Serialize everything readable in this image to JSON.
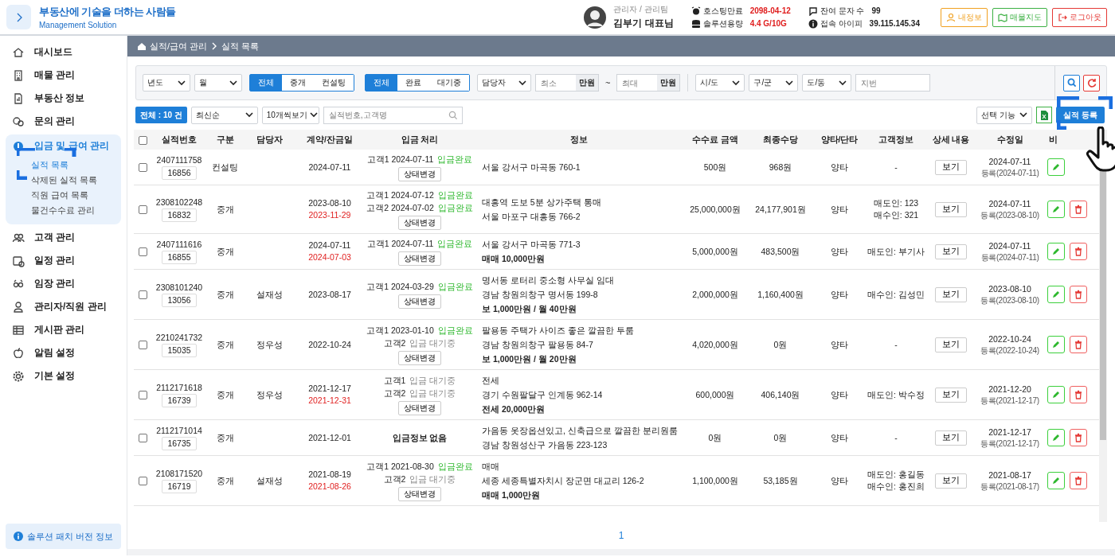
{
  "header": {
    "brand_title": "부동산에 기술을 더하는 사람들",
    "brand_subtitle": "Management Solution",
    "user_role": "관리자 / 관리팀",
    "user_name": "김부기 대표님",
    "stats": [
      {
        "label": "호스팅만료",
        "value": "2098-04-12",
        "color": "#e02020"
      },
      {
        "label": "솔루션용량",
        "value": "4.4 G/10G",
        "color": "#e02020"
      },
      {
        "label": "잔여 문자 수",
        "value": "99",
        "color": "#222222"
      },
      {
        "label": "접속 아이피",
        "value": "39.115.145.34",
        "color": "#222222"
      }
    ],
    "buttons": [
      {
        "label": "내정보",
        "color": "#f0a020"
      },
      {
        "label": "매물지도",
        "color": "#3cb043"
      },
      {
        "label": "로그아웃",
        "color": "#e53935"
      }
    ]
  },
  "sidebar": {
    "items": [
      {
        "label": "대시보드",
        "expanded": false
      },
      {
        "label": "매물 관리",
        "expanded": false
      },
      {
        "label": "부동산 정보",
        "expanded": false
      },
      {
        "label": "문의 관리",
        "expanded": false
      },
      {
        "label": "입금 및 급여 관리",
        "expanded": true,
        "children": [
          {
            "label": "실적 목록",
            "selected": true
          },
          {
            "label": "삭제된 실적 목록",
            "selected": false
          },
          {
            "label": "직원 급여 목록",
            "selected": false
          },
          {
            "label": "물건수수료 관리",
            "selected": false
          }
        ]
      },
      {
        "label": "고객 관리",
        "expanded": false
      },
      {
        "label": "일정 관리",
        "expanded": false
      },
      {
        "label": "임장 관리",
        "expanded": false
      },
      {
        "label": "관리자/직원 관리",
        "expanded": false
      },
      {
        "label": "게시판 관리",
        "expanded": false
      },
      {
        "label": "알림 설정",
        "expanded": false
      },
      {
        "label": "기본 설정",
        "expanded": false
      }
    ],
    "footer": "솔루션 패치 버전 정보"
  },
  "breadcrumb": [
    "실적/급여 관리",
    "실적 목록"
  ],
  "filters": {
    "year": "년도",
    "month": "월",
    "segments": [
      [
        {
          "label": "전체",
          "selected": true
        },
        {
          "label": "중개",
          "selected": false
        },
        {
          "label": "컨설팅",
          "selected": false
        }
      ],
      [
        {
          "label": "전체",
          "selected": true
        },
        {
          "label": "완료",
          "selected": false
        },
        {
          "label": "대기중",
          "selected": false
        }
      ]
    ],
    "manager": "담당자",
    "min_placeholder": "최소",
    "unit_min": "만원",
    "range_sep": "~",
    "max_placeholder": "최대",
    "unit_max": "만원",
    "regions": [
      "시/도",
      "구/군",
      "도/동"
    ],
    "lot_placeholder": "지번"
  },
  "toolbar": {
    "total": "전체 : 10 건",
    "sort": "최신순",
    "per_page": "10개씩보기",
    "search_placeholder": "실적번호,고객명",
    "bulk": "선택 기능",
    "register": "실적 등록"
  },
  "table": {
    "all_checked": false,
    "columns": [
      "실적번호",
      "구분",
      "담당자",
      "계약/잔금일",
      "입금 처리",
      "정보",
      "수수료 금액",
      "최종수당",
      "양타/단타",
      "고객정보",
      "상세 내용",
      "수정일",
      "비"
    ],
    "rows": [
      {
        "checked": false,
        "number": "2407111758",
        "code": "16856",
        "category": "컨설팅",
        "contract_date": "2024-07-11",
        "payments": [
          {
            "customer": "고객1",
            "date": "2024-07-11",
            "status": "입금완료",
            "paid": true
          }
        ],
        "status_button": "상태변경",
        "info": [
          {
            "text": "서울 강서구 마곡동 760-1",
            "bold": false
          }
        ],
        "fee": "500원",
        "allowance": "968원",
        "trade": "양타",
        "customer_info": [
          "-"
        ],
        "detail": "보기",
        "modified": "2024-07-11",
        "registered": "등록(2024-07-11)",
        "actions": [
          {
            "kind": "edit"
          }
        ]
      },
      {
        "checked": false,
        "number": "2308102248",
        "code": "16832",
        "category": "중개",
        "contract_date": "2023-08-10",
        "balance_date": "2023-11-29",
        "payments": [
          {
            "customer": "고객1",
            "date": "2024-07-12",
            "status": "입금완료",
            "paid": true
          },
          {
            "customer": "고객2",
            "date": "2024-07-02",
            "status": "입금완료",
            "paid": true
          }
        ],
        "status_button": "상태변경",
        "info": [
          {
            "text": "대흥역 도보 5분 상가주택 통매",
            "bold": false
          },
          {
            "text": "서울 마포구 대흥동 766-2",
            "bold": false
          }
        ],
        "fee": "25,000,000원",
        "allowance": "24,177,901원",
        "trade": "양타",
        "customer_info": [
          "매도인: 123",
          "매수인: 321"
        ],
        "detail": "보기",
        "modified": "2024-07-11",
        "registered": "등록(2023-08-10)",
        "actions": [
          {
            "kind": "edit"
          },
          {
            "kind": "delete"
          }
        ]
      },
      {
        "checked": false,
        "number": "2407111616",
        "code": "16855",
        "category": "중개",
        "contract_date": "2024-07-11",
        "balance_date": "2024-07-03",
        "payments": [
          {
            "customer": "고객1",
            "date": "2024-07-11",
            "status": "입금완료",
            "paid": true
          }
        ],
        "status_button": "상태변경",
        "info": [
          {
            "text": "서울 강서구 마곡동 771-3",
            "bold": false
          },
          {
            "text": "매매 10,000만원",
            "bold": true
          }
        ],
        "fee": "5,000,000원",
        "allowance": "483,500원",
        "trade": "양타",
        "customer_info": [
          "매도인: 부기사"
        ],
        "detail": "보기",
        "modified": "2024-07-11",
        "registered": "등록(2024-07-11)",
        "actions": [
          {
            "kind": "edit"
          },
          {
            "kind": "delete"
          }
        ]
      },
      {
        "checked": false,
        "number": "2308101240",
        "code": "13056",
        "category": "중개",
        "manager": "설재성",
        "contract_date": "2023-08-17",
        "payments": [
          {
            "customer": "고객1",
            "date": "2024-03-29",
            "status": "입금완료",
            "paid": true
          }
        ],
        "status_button": "상태변경",
        "info": [
          {
            "text": "명서동 로터리 중소형 사무실 임대",
            "bold": false
          },
          {
            "text": "경남 창원의창구 명서동 199-8",
            "bold": false
          },
          {
            "text": "보 1,000만원 / 월 40만원",
            "bold": true
          }
        ],
        "fee": "2,000,000원",
        "allowance": "1,160,400원",
        "trade": "양타",
        "customer_info": [
          "매수인: 김성민"
        ],
        "detail": "보기",
        "modified": "2023-08-10",
        "registered": "등록(2023-08-10)",
        "actions": [
          {
            "kind": "edit"
          },
          {
            "kind": "delete"
          }
        ]
      },
      {
        "checked": false,
        "number": "2210241732",
        "code": "15035",
        "category": "중개",
        "manager": "정우성",
        "contract_date": "2022-10-24",
        "payments": [
          {
            "customer": "고객1",
            "date": "2023-01-10",
            "status": "입금완료",
            "paid": true
          },
          {
            "customer": "고객2",
            "status": "입금 대기중",
            "paid": false
          }
        ],
        "status_button": "상태변경",
        "info": [
          {
            "text": "팔용동 주택가 사이즈 좋은 깔끔한 투룸",
            "bold": false
          },
          {
            "text": "경남 창원의창구 팔용동 84-7",
            "bold": false
          },
          {
            "text": "보 1,000만원 / 월 20만원",
            "bold": true
          }
        ],
        "fee": "4,020,000원",
        "allowance": "0원",
        "trade": "양타",
        "customer_info": [
          "-"
        ],
        "detail": "보기",
        "modified": "2022-10-24",
        "registered": "등록(2022-10-24)",
        "actions": [
          {
            "kind": "edit"
          },
          {
            "kind": "delete"
          }
        ]
      },
      {
        "checked": false,
        "number": "2112171618",
        "code": "16739",
        "category": "중개",
        "manager": "정우성",
        "contract_date": "2021-12-17",
        "balance_date": "2021-12-31",
        "payments": [
          {
            "customer": "고객1",
            "status": "입금 대기중",
            "paid": false
          },
          {
            "customer": "고객2",
            "status": "입금 대기중",
            "paid": false
          }
        ],
        "status_button": "상태변경",
        "info": [
          {
            "text": "전세",
            "bold": false
          },
          {
            "text": "경기 수원팔달구 인계동 962-14",
            "bold": false
          },
          {
            "text": "전세 20,000만원",
            "bold": true
          }
        ],
        "fee": "600,000원",
        "allowance": "406,140원",
        "trade": "양타",
        "customer_info": [
          "매도인: 박수정"
        ],
        "detail": "보기",
        "modified": "2021-12-20",
        "registered": "등록(2021-12-17)",
        "actions": [
          {
            "kind": "edit"
          },
          {
            "kind": "delete"
          }
        ]
      },
      {
        "checked": false,
        "number": "2112171014",
        "code": "16735",
        "category": "중개",
        "contract_date": "2021-12-01",
        "payment_note": "입금정보 없음",
        "info": [
          {
            "text": "가음동 옷장옵션있고, 신축급으로 깔끔한 분리원룸",
            "bold": false
          },
          {
            "text": "경남 창원성산구 가음동 223-123",
            "bold": false
          }
        ],
        "fee": "0원",
        "allowance": "0원",
        "trade": "양타",
        "customer_info": [
          "-"
        ],
        "detail": "보기",
        "modified": "2021-12-17",
        "registered": "등록(2021-12-17)",
        "actions": [
          {
            "kind": "edit"
          },
          {
            "kind": "delete"
          }
        ]
      },
      {
        "checked": false,
        "number": "2108171520",
        "code": "16719",
        "category": "중개",
        "manager": "설재성",
        "contract_date": "2021-08-19",
        "balance_date": "2021-08-26",
        "payments": [
          {
            "customer": "고객1",
            "date": "2021-08-30",
            "status": "입금완료",
            "paid": true
          },
          {
            "customer": "고객2",
            "status": "입금 대기중",
            "paid": false
          }
        ],
        "status_button": "상태변경",
        "info": [
          {
            "text": "매매",
            "bold": false
          },
          {
            "text": "세종 세종특별자치시 장군면 대교리 126-2",
            "bold": false
          },
          {
            "text": "매매 1,000만원",
            "bold": true
          }
        ],
        "fee": "1,100,000원",
        "allowance": "53,185원",
        "trade": "양타",
        "customer_info": [
          "매도인: 홍길동",
          "매수인: 홍진희"
        ],
        "detail": "보기",
        "modified": "2021-08-17",
        "registered": "등록(2021-08-17)",
        "actions": [
          {
            "kind": "edit"
          },
          {
            "kind": "delete"
          }
        ]
      }
    ]
  },
  "pagination": [
    {
      "label": "1",
      "selected": true
    }
  ]
}
